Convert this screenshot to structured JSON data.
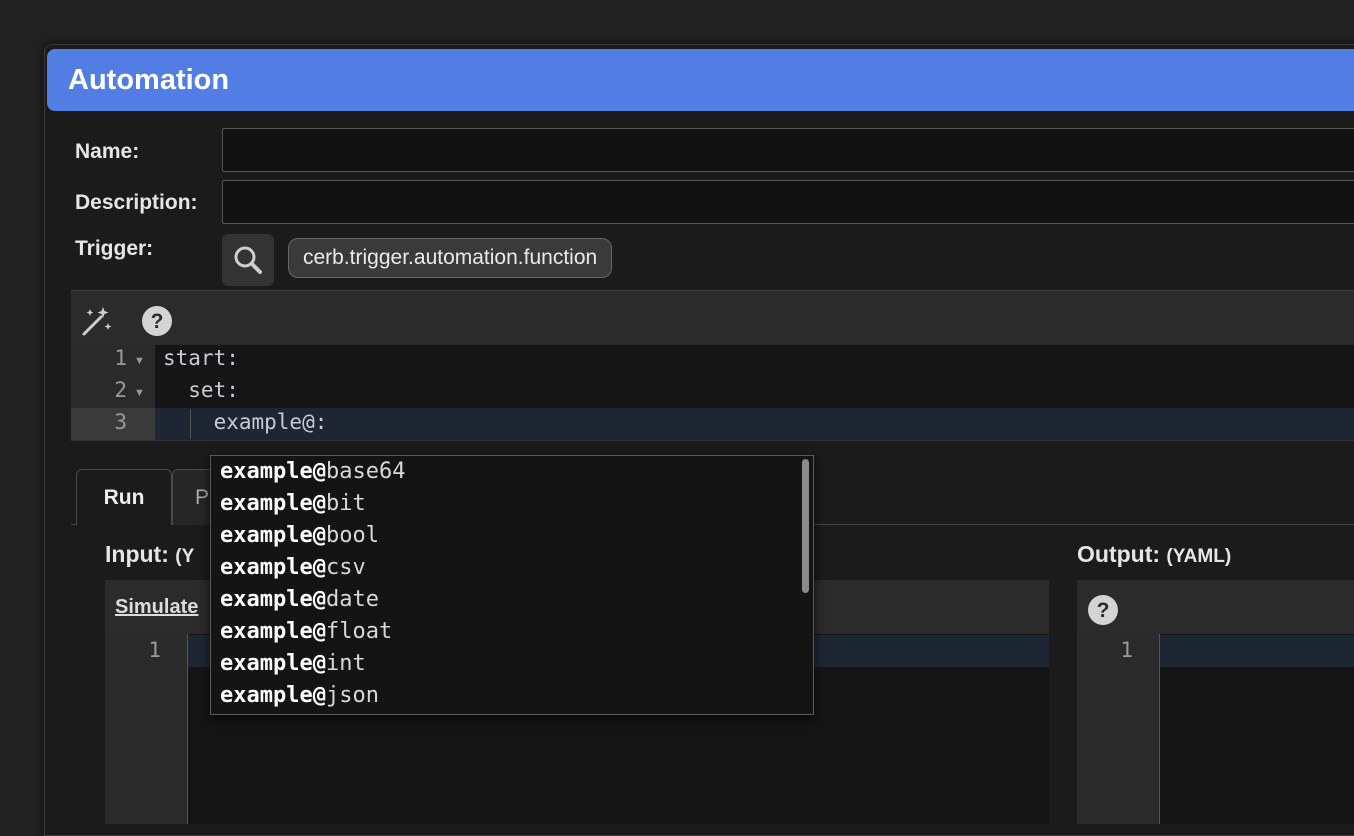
{
  "dialog": {
    "title": "Automation"
  },
  "form": {
    "name_label": "Name:",
    "name_value": "",
    "description_label": "Description:",
    "description_value": "",
    "trigger_label": "Trigger:",
    "trigger_value": "cerb.trigger.automation.function"
  },
  "editor": {
    "lines": [
      {
        "num": "1",
        "text": "start:",
        "foldable": true
      },
      {
        "num": "2",
        "text": "  set:",
        "foldable": true
      },
      {
        "num": "3",
        "text": "    example@:",
        "foldable": false
      }
    ],
    "toolbar_icons": [
      "magic-wand-icon",
      "help-icon"
    ]
  },
  "autocomplete": {
    "prefix": "example@",
    "items": [
      "base64",
      "bit",
      "bool",
      "csv",
      "date",
      "float",
      "int",
      "json"
    ]
  },
  "tabs": [
    {
      "label": "Run",
      "active": true
    },
    {
      "label": "P",
      "active": false
    }
  ],
  "input_panel": {
    "title": "Input:",
    "title_suffix": "(Y",
    "simulate_link": "Simulate",
    "line_num": "1"
  },
  "output_panel": {
    "title": "Output:",
    "title_suffix": "(YAML)",
    "line_num": "1"
  },
  "colors": {
    "title_bar": "#527ee4",
    "background": "#1b1b1b",
    "active_line": "#1e2633"
  }
}
